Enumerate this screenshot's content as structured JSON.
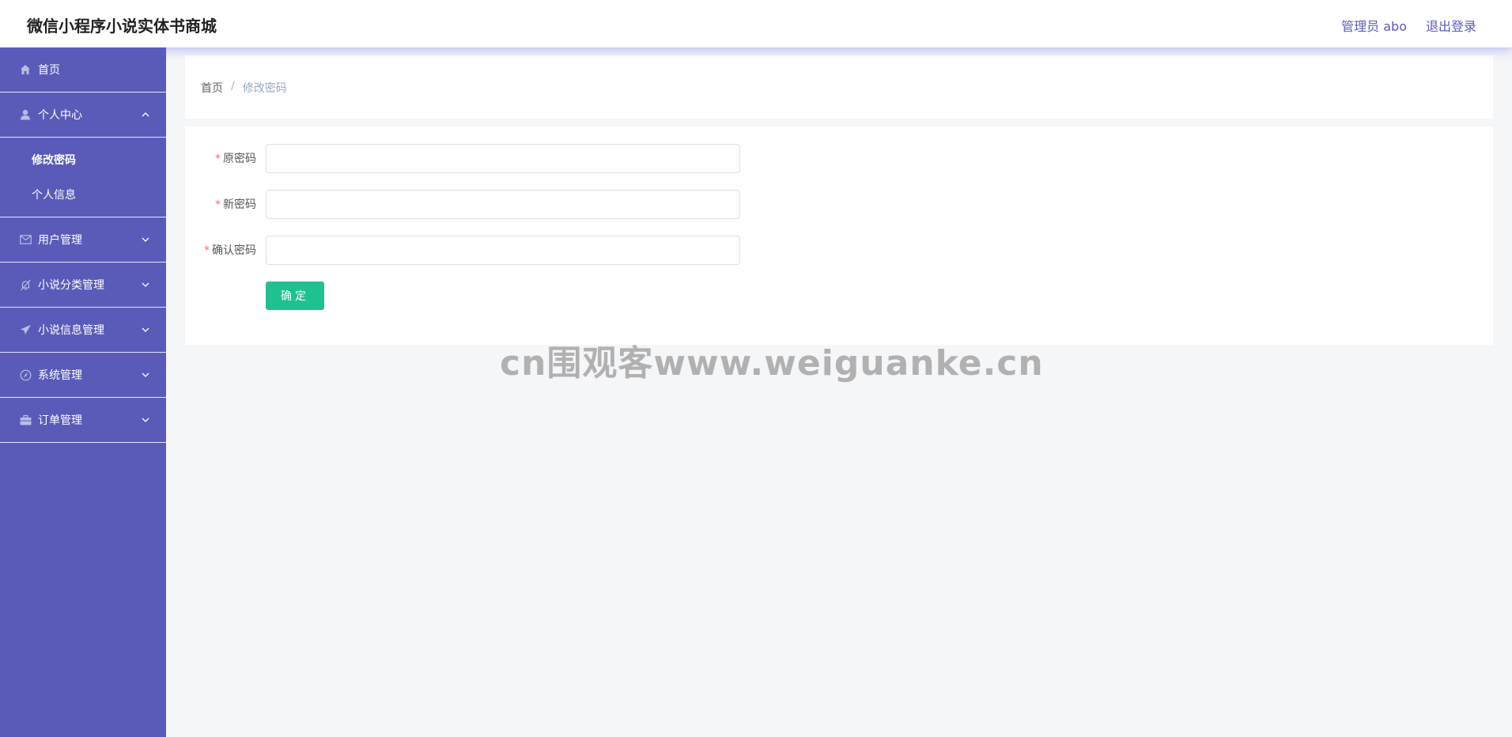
{
  "header": {
    "title": "微信小程序小说实体书商城",
    "user_label": "管理员 abo",
    "logout_label": "退出登录"
  },
  "sidebar": {
    "items": [
      {
        "label": "首页",
        "icon": "home-icon"
      },
      {
        "label": "个人中心",
        "icon": "user-icon",
        "expanded": true,
        "children": [
          {
            "label": "修改密码",
            "active": true
          },
          {
            "label": "个人信息"
          }
        ]
      },
      {
        "label": "用户管理",
        "icon": "mail-icon"
      },
      {
        "label": "小说分类管理",
        "icon": "bell-off-icon"
      },
      {
        "label": "小说信息管理",
        "icon": "send-icon"
      },
      {
        "label": "系统管理",
        "icon": "compass-icon"
      },
      {
        "label": "订单管理",
        "icon": "briefcase-icon"
      }
    ]
  },
  "breadcrumb": {
    "home": "首页",
    "separator": "/",
    "current": "修改密码"
  },
  "form": {
    "required_mark": "*",
    "fields": [
      {
        "label": "原密码",
        "value": "",
        "placeholder": ""
      },
      {
        "label": "新密码",
        "value": "",
        "placeholder": ""
      },
      {
        "label": "确认密码",
        "value": "",
        "placeholder": ""
      }
    ],
    "submit_label": "确定"
  },
  "watermark": "cn围观客www.weiguanke.cn",
  "colors": {
    "sidebar_bg": "#5a5bb8",
    "accent_button": "#1fc190",
    "required": "#f56c6c",
    "page_bg": "#f5f6f8"
  }
}
